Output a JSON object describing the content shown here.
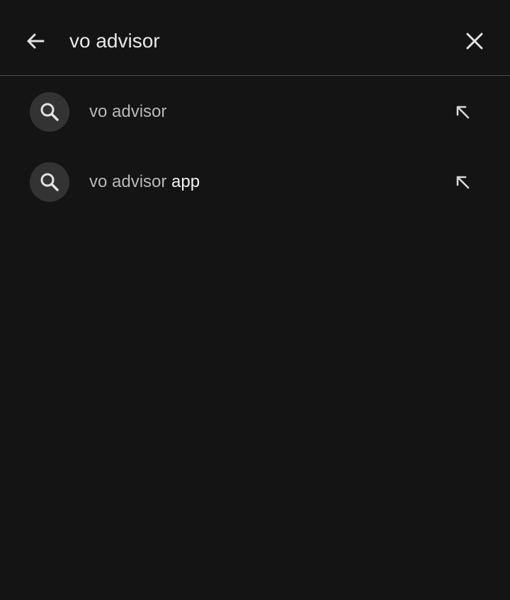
{
  "search": {
    "query": "vo advisor",
    "back_icon": "arrow-back-icon",
    "clear_icon": "close-icon"
  },
  "suggestions": [
    {
      "match": "vo advisor",
      "completion": "",
      "icon": "search-icon",
      "action_icon": "arrow-up-left-icon"
    },
    {
      "match": "vo advisor",
      "completion": " app",
      "icon": "search-icon",
      "action_icon": "arrow-up-left-icon"
    }
  ],
  "colors": {
    "background": "#141414",
    "divider": "#4a4a4a",
    "icon_circle": "#333333",
    "text_primary": "#f2f2f2",
    "text_muted": "#b8b8b8"
  }
}
